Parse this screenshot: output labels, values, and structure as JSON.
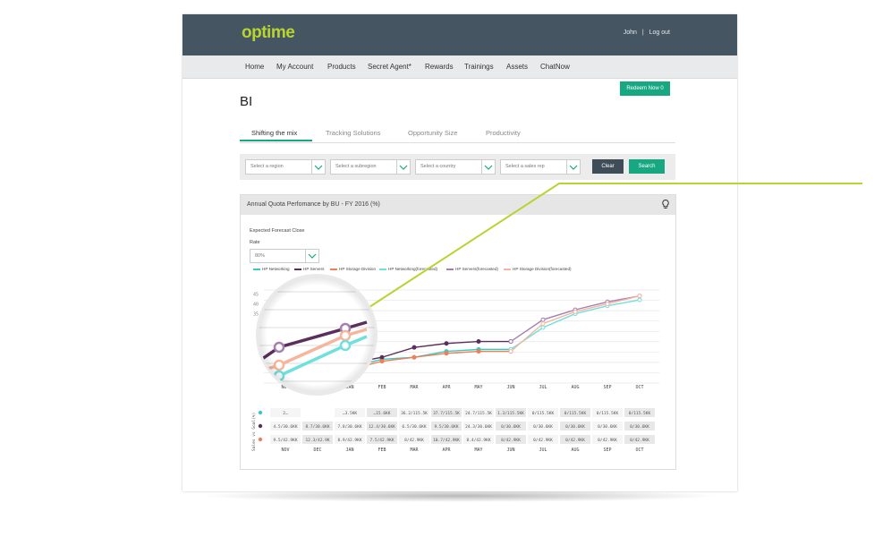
{
  "header": {
    "logo": "optime",
    "user": "John",
    "separator": "|",
    "logout": "Log out"
  },
  "nav": {
    "items": [
      "Home",
      "My Account",
      "Products",
      "Secret Agent*",
      "Rewards",
      "Trainings",
      "Assets",
      "ChatNow"
    ]
  },
  "redeem_label": "Redeem Now 0",
  "page_title": "BI",
  "tabs": [
    "Shifting the mix",
    "Tracking Solutions",
    "Opportunity Size",
    "Productivity"
  ],
  "filters": {
    "region": "Select a region",
    "subregion": "Select a subregion",
    "country": "Select a country",
    "sales_rep": "Select a sales rep",
    "clear": "Clear",
    "search": "Search"
  },
  "panel": {
    "title": "Annual Quota Perfomance by BU - FY 2016 (%)",
    "forecast_label": "Expected Forecast Close",
    "rate_label": "Rate",
    "rate_value": "80%",
    "table_axis_label": "Sales vs Goal(%)"
  },
  "colors": {
    "accent": "#17a882",
    "navy": "#455562",
    "lime": "#b8d431",
    "teal": "#5fd8d2",
    "purple": "#5a2f5c",
    "orange": "#f07e57",
    "teal_fc": "#6fe0dc",
    "purple_fc": "#a47fb0",
    "orange_fc": "#f7b59e"
  },
  "chart_data": {
    "type": "line",
    "x": [
      "NOV",
      "DEC",
      "JAN",
      "FEB",
      "MAR",
      "APR",
      "MAY",
      "JUN",
      "JUL",
      "AUG",
      "SEP",
      "OCT"
    ],
    "y_ticks": [
      45,
      40,
      35
    ],
    "series": [
      {
        "name": "HP Networking",
        "color": "#3cc9c3",
        "values": [
          3,
          5,
          8,
          12,
          13,
          16,
          17,
          17,
          null,
          null,
          null,
          null
        ]
      },
      {
        "name": "HP Servers",
        "color": "#5a2f5c",
        "values": [
          4,
          8,
          10,
          13,
          18,
          20,
          21,
          21,
          null,
          null,
          null,
          null
        ]
      },
      {
        "name": "HP Storage Division",
        "color": "#f07e57",
        "values": [
          2,
          4,
          7,
          11,
          13,
          15,
          16,
          16,
          null,
          null,
          null,
          null
        ]
      },
      {
        "name": "HP Networking(forecasted)",
        "color": "#6fe0dc",
        "values": [
          null,
          null,
          null,
          null,
          null,
          null,
          null,
          17,
          28,
          35,
          39,
          42
        ]
      },
      {
        "name": "HP Servers(forecasted)",
        "color": "#a47fb0",
        "values": [
          null,
          null,
          null,
          null,
          null,
          null,
          null,
          21,
          32,
          37,
          41,
          44
        ]
      },
      {
        "name": "HP Storage Division(forecasted)",
        "color": "#f7b59e",
        "values": [
          null,
          null,
          null,
          null,
          null,
          null,
          null,
          16,
          30,
          36,
          40,
          44
        ]
      }
    ],
    "ylim": [
      0,
      47
    ],
    "table": {
      "rows": [
        {
          "color": "#3cc9c3",
          "cells": [
            "2…",
            "",
            "…3.5KK",
            "…15.6KK",
            "36.2/115.5K",
            "37.7/115.5K",
            "24.7/115.5K",
            "1.3/115.5KK",
            "0/115.5KK",
            "0/115.5KK",
            "0/115.5KK",
            "0/115.5KK"
          ]
        },
        {
          "color": "#5a2f5c",
          "cells": [
            "4.5/30.6KK",
            "8.7/30.6KK",
            "7.8/30.6KK",
            "12.4/30.6KK",
            "6.5/30.6KK",
            "9.5/30.6KK",
            "24.3/30.6KK",
            "0/30.6KK",
            "0/30.6KK",
            "0/30.6KK",
            "0/30.6KK",
            "0/30.6KK"
          ]
        },
        {
          "color": "#f07e57",
          "cells": [
            "9.5/42.9KK",
            "12.3/42.9K",
            "8.9/42.9KK",
            "7.5/42.9KK",
            "8/42.9KK",
            "10.7/42.9KK",
            "8.4/42.9KK",
            "8/42.9KK",
            "0/42.9KK",
            "0/42.9KK",
            "0/42.9KK",
            "0/42.9KK"
          ]
        }
      ]
    }
  }
}
